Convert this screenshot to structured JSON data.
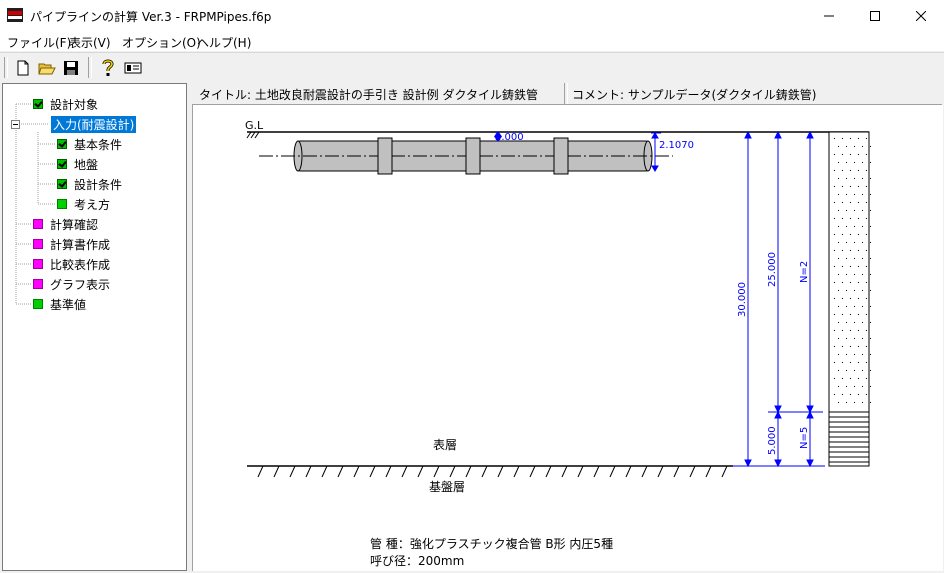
{
  "window": {
    "title": "パイプラインの計算 Ver.3 - FRPMPipes.f6p"
  },
  "menu": [
    {
      "label": "ファイル(F)"
    },
    {
      "label": "表示(V)"
    },
    {
      "label": "オプション(O)"
    },
    {
      "label": "ヘルプ(H)"
    }
  ],
  "tree": [
    {
      "label": "設計対象",
      "icon": "check-icon"
    },
    {
      "label": "入力(耐震設計)",
      "icon": "none"
    },
    {
      "label": "基本条件",
      "icon": "check-icon"
    },
    {
      "label": "地盤",
      "icon": "check-icon"
    },
    {
      "label": "設計条件",
      "icon": "check-icon"
    },
    {
      "label": "考え方",
      "icon": "green-square-icon"
    },
    {
      "label": "計算確認",
      "icon": "magenta-square-icon"
    },
    {
      "label": "計算書作成",
      "icon": "magenta-square-icon"
    },
    {
      "label": "比較表作成",
      "icon": "magenta-square-icon"
    },
    {
      "label": "グラフ表示",
      "icon": "magenta-square-icon"
    },
    {
      "label": "基準値",
      "icon": "green-square-icon"
    }
  ],
  "header": {
    "title": "タイトル: 土地改良耐震設計の手引き  設計例  ダクタイル鋳鉄管",
    "comment": "コメント: サンプルデータ(ダクタイル鋳鉄管)"
  },
  "drawing": {
    "gl_label": "G.L",
    "cover_dim": "2.000",
    "pipe_dia_dim": "2.1070",
    "depth_total": "30.000",
    "depth_upper": "25.000",
    "depth_lower": "5.000",
    "n_upper": "N=2",
    "n_lower": "N=5",
    "surface_label": "表層",
    "base_label": "基盤層",
    "pipe_type": "管  種：強化プラスチック複合管 B形 内圧5種",
    "nominal_dia": "呼び径：200mm"
  },
  "colors": {
    "dimension": "#0000ff",
    "pipe_fill": "#c0c0c0",
    "selection": "#0078d7",
    "ok": "#00c000",
    "todo": "#ff00ff"
  }
}
